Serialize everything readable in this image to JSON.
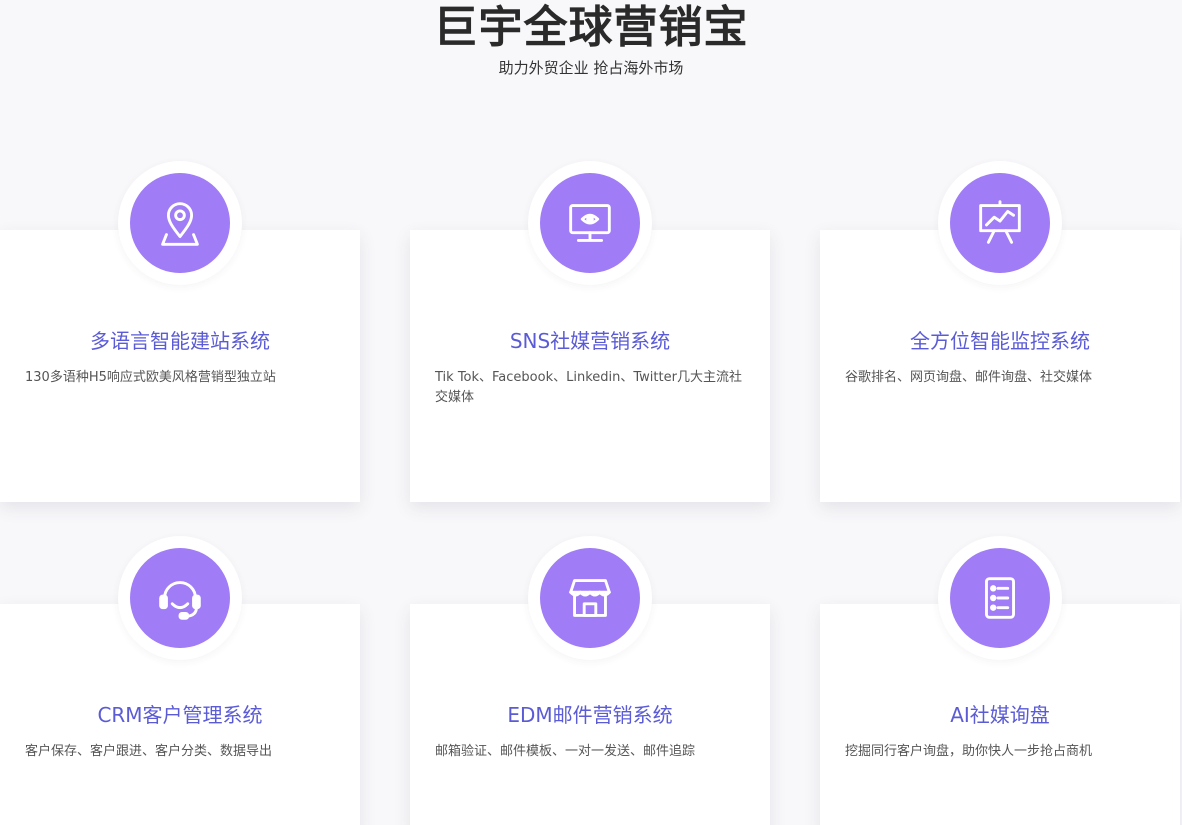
{
  "hero": {
    "title": "巨宇全球营销宝",
    "subtitle": "助力外贸企业 抢占海外市场"
  },
  "colors": {
    "accent": "#a07cf6",
    "title_blue": "#5b5bd6",
    "background": "#f8f8fa"
  },
  "cards": [
    {
      "icon": "location-pin-icon",
      "title": "多语言智能建站系统",
      "desc": "130多语种H5响应式欧美风格营销型独立站"
    },
    {
      "icon": "monitor-eye-icon",
      "title": "SNS社媒营销系统",
      "desc": "Tik Tok、Facebook、Linkedin、Twitter几大主流社交媒体"
    },
    {
      "icon": "presentation-chart-icon",
      "title": "全方位智能监控系统",
      "desc": "谷歌排名、网页询盘、邮件询盘、社交媒体"
    },
    {
      "icon": "headset-icon",
      "title": "CRM客户管理系统",
      "desc": "客户保存、客户跟进、客户分类、数据导出"
    },
    {
      "icon": "storefront-icon",
      "title": "EDM邮件营销系统",
      "desc": "邮箱验证、邮件模板、一对一发送、邮件追踪"
    },
    {
      "icon": "document-list-icon",
      "title": "AI社媒询盘",
      "desc": "挖掘同行客户询盘，助你快人一步抢占商机"
    }
  ]
}
